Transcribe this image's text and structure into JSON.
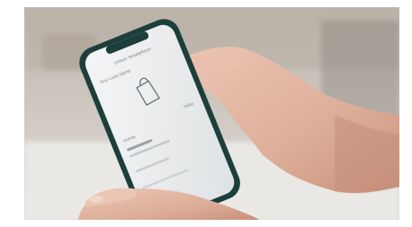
{
  "photo": {
    "description_label": "",
    "colors": {
      "background_top": "#cfc9c2",
      "background_bottom": "#ecebe8",
      "skin": "#e2b9a6",
      "skin_shadow": "#c98f7c",
      "phone_case": "#1d3f3c",
      "screen": "#eef0f1"
    }
  },
  "phone_screen": {
    "status_time": "",
    "nav_title": "Unlock Smartphone",
    "subtitle": "Your Lock Name",
    "section_label": "Activity",
    "side_label": "Today",
    "lock_icon": "lock-outline-icon"
  }
}
